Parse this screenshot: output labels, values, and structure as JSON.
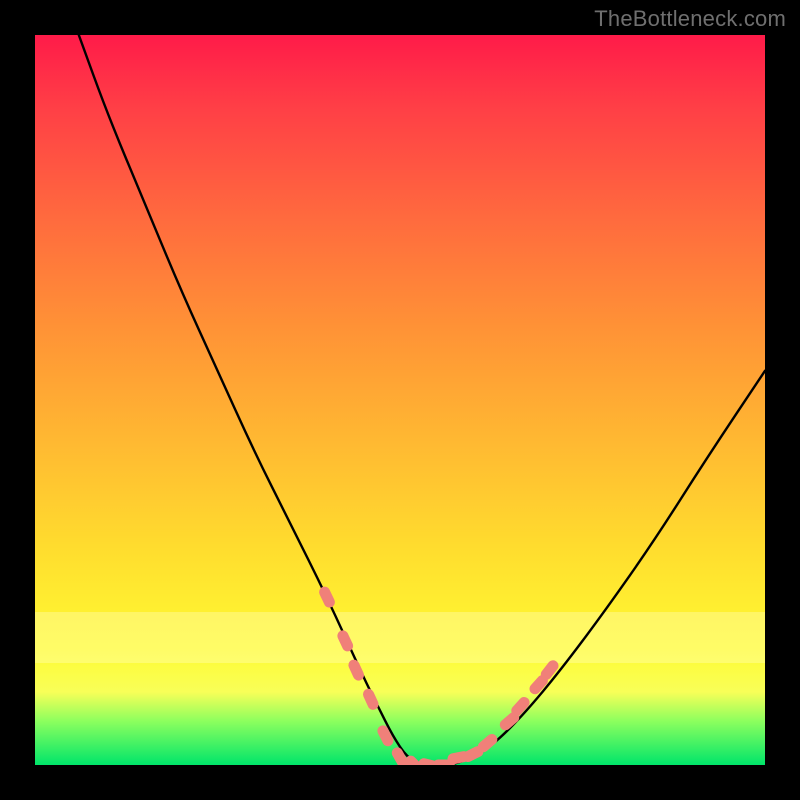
{
  "watermark": "TheBottleneck.com",
  "chart_data": {
    "type": "line",
    "title": "",
    "xlabel": "",
    "ylabel": "",
    "xlim": [
      0,
      100
    ],
    "ylim": [
      0,
      100
    ],
    "grid": false,
    "series": [
      {
        "name": "curve",
        "x": [
          6,
          10,
          15,
          20,
          25,
          30,
          35,
          40,
          45,
          47,
          49,
          51,
          53,
          55,
          57,
          60,
          63,
          67,
          72,
          78,
          85,
          92,
          100
        ],
        "values": [
          100,
          89,
          77,
          65,
          54,
          43,
          33,
          23,
          12,
          8,
          4,
          1,
          0,
          0,
          0,
          1,
          3,
          7,
          13,
          21,
          31,
          42,
          54
        ]
      }
    ],
    "markers": {
      "comment": "pink rounded dash markers along lower part of curve",
      "color": "#f08079",
      "points": [
        {
          "x": 40,
          "y": 23
        },
        {
          "x": 42.5,
          "y": 17
        },
        {
          "x": 44,
          "y": 13
        },
        {
          "x": 46,
          "y": 9
        },
        {
          "x": 48,
          "y": 4
        },
        {
          "x": 50,
          "y": 1
        },
        {
          "x": 52,
          "y": 0
        },
        {
          "x": 54,
          "y": 0
        },
        {
          "x": 56,
          "y": 0
        },
        {
          "x": 58,
          "y": 1
        },
        {
          "x": 60,
          "y": 1.5
        },
        {
          "x": 62,
          "y": 3
        },
        {
          "x": 65,
          "y": 6
        },
        {
          "x": 66.5,
          "y": 8
        },
        {
          "x": 69,
          "y": 11
        },
        {
          "x": 70.5,
          "y": 13
        }
      ]
    },
    "background_gradient": {
      "stops": [
        {
          "pos": 0,
          "color": "#ff1b49"
        },
        {
          "pos": 25,
          "color": "#ff6a3e"
        },
        {
          "pos": 55,
          "color": "#ffb732"
        },
        {
          "pos": 84,
          "color": "#fffb32"
        },
        {
          "pos": 100,
          "color": "#00e56a"
        }
      ]
    }
  }
}
